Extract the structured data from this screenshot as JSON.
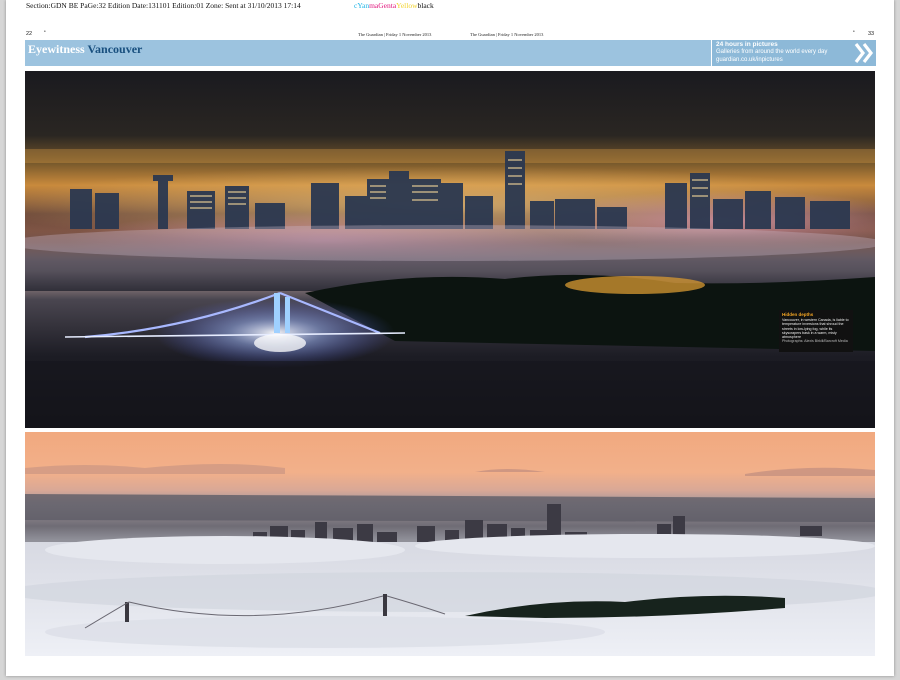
{
  "slug": "Section:GDN BE  PaGe:32  Edition Date:131101  Edition:01  Zone:   Sent at 31/10/2013 17:14",
  "plates": [
    "cYan",
    "maGenta",
    "Yellow",
    "black"
  ],
  "colors": {
    "cyan": "#19b3e6",
    "magenta": "#e0147c",
    "yellow": "#f2d22a",
    "black": "#111111",
    "banner": "#9cc3df",
    "kicker_accent": "#184f7e",
    "caption_head": "#f5a623"
  },
  "folio": {
    "left": "22",
    "right": "33"
  },
  "dateline": {
    "left": "The Guardian | Friday 1 November 2013",
    "right": "The Guardian | Friday 1 November 2013"
  },
  "banner": {
    "kicker_1": "Eyewitness",
    "kicker_2": "Vancouver",
    "promo_title": "24 hours in pictures",
    "promo_text": "Galleries from around the world every day",
    "promo_url": "guardian.co.uk/inpictures",
    "promo_icon": "double-chevron-right-icon"
  },
  "caption": {
    "head": "Hidden depths",
    "body": "Vancouver, in western Canada, is liable to temperature inversions that shroud the streets in low-lying fog, while its skyscrapers bask in a warm, misty atmosphere",
    "credit": "Photographs: Alexis Birkill/Barcroft Media"
  }
}
